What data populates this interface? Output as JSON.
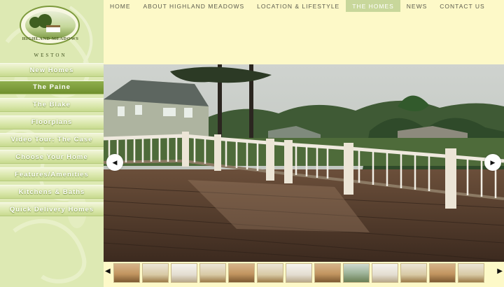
{
  "logo": {
    "name": "HIGHLAND MEADOWS",
    "location": "WESTON"
  },
  "top_nav": {
    "items": [
      {
        "label": "HOME",
        "active": false
      },
      {
        "label": "ABOUT HIGHLAND MEADOWS",
        "active": false
      },
      {
        "label": "LOCATION & LIFESTYLE",
        "active": false
      },
      {
        "label": "THE HOMES",
        "active": true
      },
      {
        "label": "NEWS",
        "active": false
      },
      {
        "label": "CONTACT US",
        "active": false
      }
    ]
  },
  "side_nav": {
    "items": [
      {
        "label": "New Homes",
        "active": false
      },
      {
        "label": "The Paine",
        "active": true
      },
      {
        "label": "The Blake",
        "active": false
      },
      {
        "label": "Floorplans",
        "active": false
      },
      {
        "label": "Video Tour: The Case",
        "active": false
      },
      {
        "label": "Choose Your Home",
        "active": false
      },
      {
        "label": "Features/Amenities",
        "active": false
      },
      {
        "label": "Kitchens & Baths",
        "active": false
      },
      {
        "label": "Quick Delivery Homes",
        "active": false
      }
    ]
  },
  "slideshow": {
    "prev_icon": "arrow-left-icon",
    "next_icon": "arrow-right-icon",
    "prev_glyph": "◀",
    "next_glyph": "▶"
  },
  "thumbnails": {
    "prev_glyph": "◀",
    "next_glyph": "▶",
    "count": 13
  },
  "colors": {
    "page_bg": "#fdf9c8",
    "sidebar_bg": "#dde9b3",
    "active_side": "#7a9a36",
    "active_top": "#c8d79b",
    "nav_text": "#5b5b4e"
  }
}
